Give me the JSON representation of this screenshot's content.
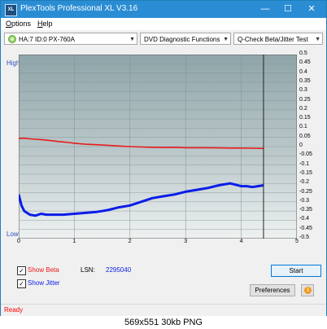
{
  "window": {
    "title": "PlexTools Professional XL V3.16",
    "app_icon_text": "XL",
    "buttons": {
      "minimize": "—",
      "maximize": "☐",
      "close": "✕"
    }
  },
  "menu": {
    "items": [
      {
        "label": "Options",
        "accel": "O",
        "rest": "ptions"
      },
      {
        "label": "Help",
        "accel": "H",
        "rest": "elp"
      }
    ]
  },
  "toolbar": {
    "drive": "HA:7 ID:0  PX-760A",
    "function": "DVD Diagnostic Functions",
    "test": "Q-Check Beta/Jitter Test"
  },
  "chart_data": {
    "type": "line",
    "left_axis": {
      "high_label": "High",
      "low_label": "Low"
    },
    "right_axis": {
      "ylim": [
        -0.5,
        0.5
      ],
      "ticks": [
        "0.5",
        "0.45",
        "0.4",
        "0.35",
        "0.3",
        "0.25",
        "0.2",
        "0.15",
        "0.1",
        "0.05",
        "0",
        "-0.05",
        "-0.1",
        "-0.15",
        "-0.2",
        "-0.25",
        "-0.3",
        "-0.35",
        "-0.4",
        "-0.45",
        "-0.5"
      ]
    },
    "x_axis": {
      "xlim": [
        0,
        5
      ],
      "ticks": [
        "0",
        "1",
        "2",
        "3",
        "4",
        "5"
      ]
    },
    "end_marker_x": 4.4,
    "series": [
      {
        "key": "beta",
        "color": "#e81c1c",
        "x": [
          0,
          0.1,
          0.2,
          0.3,
          0.4,
          0.5,
          0.6,
          0.7,
          0.8,
          0.9,
          1.0,
          1.2,
          1.4,
          1.6,
          1.8,
          2.0,
          2.2,
          2.4,
          2.6,
          2.8,
          3.0,
          3.2,
          3.4,
          3.6,
          3.8,
          4.0,
          4.2,
          4.4
        ],
        "y": [
          0.045,
          0.045,
          0.042,
          0.04,
          0.038,
          0.035,
          0.032,
          0.028,
          0.025,
          0.022,
          0.018,
          0.013,
          0.01,
          0.007,
          0.003,
          0.0,
          -0.002,
          -0.004,
          -0.005,
          -0.004,
          -0.006,
          -0.006,
          -0.006,
          -0.007,
          -0.008,
          -0.008,
          -0.009,
          -0.01
        ]
      },
      {
        "key": "jitter",
        "color": "#0a1de8",
        "x": [
          0,
          0.05,
          0.1,
          0.2,
          0.3,
          0.4,
          0.5,
          0.6,
          0.8,
          1.0,
          1.2,
          1.4,
          1.6,
          1.8,
          2.0,
          2.2,
          2.4,
          2.6,
          2.8,
          3.0,
          3.2,
          3.4,
          3.6,
          3.8,
          4.0,
          4.1,
          4.2,
          4.3,
          4.4
        ],
        "y": [
          -0.26,
          -0.32,
          -0.35,
          -0.37,
          -0.375,
          -0.365,
          -0.37,
          -0.37,
          -0.37,
          -0.365,
          -0.36,
          -0.355,
          -0.345,
          -0.33,
          -0.32,
          -0.3,
          -0.28,
          -0.27,
          -0.26,
          -0.245,
          -0.235,
          -0.225,
          -0.21,
          -0.2,
          -0.215,
          -0.215,
          -0.22,
          -0.215,
          -0.21
        ]
      }
    ]
  },
  "controls": {
    "show_beta": {
      "label": "Show Beta",
      "checked": true,
      "color": "#e81c1c"
    },
    "show_jitter": {
      "label": "Show Jitter",
      "checked": true,
      "color": "#0a1de8"
    },
    "lsn_label": "LSN:",
    "lsn_value": "2295040",
    "start_label": "Start",
    "preferences_label": "Preferences",
    "info_icon_glyph": "i"
  },
  "status": {
    "text": "Ready"
  },
  "caption": "569x551  30kb  PNG"
}
